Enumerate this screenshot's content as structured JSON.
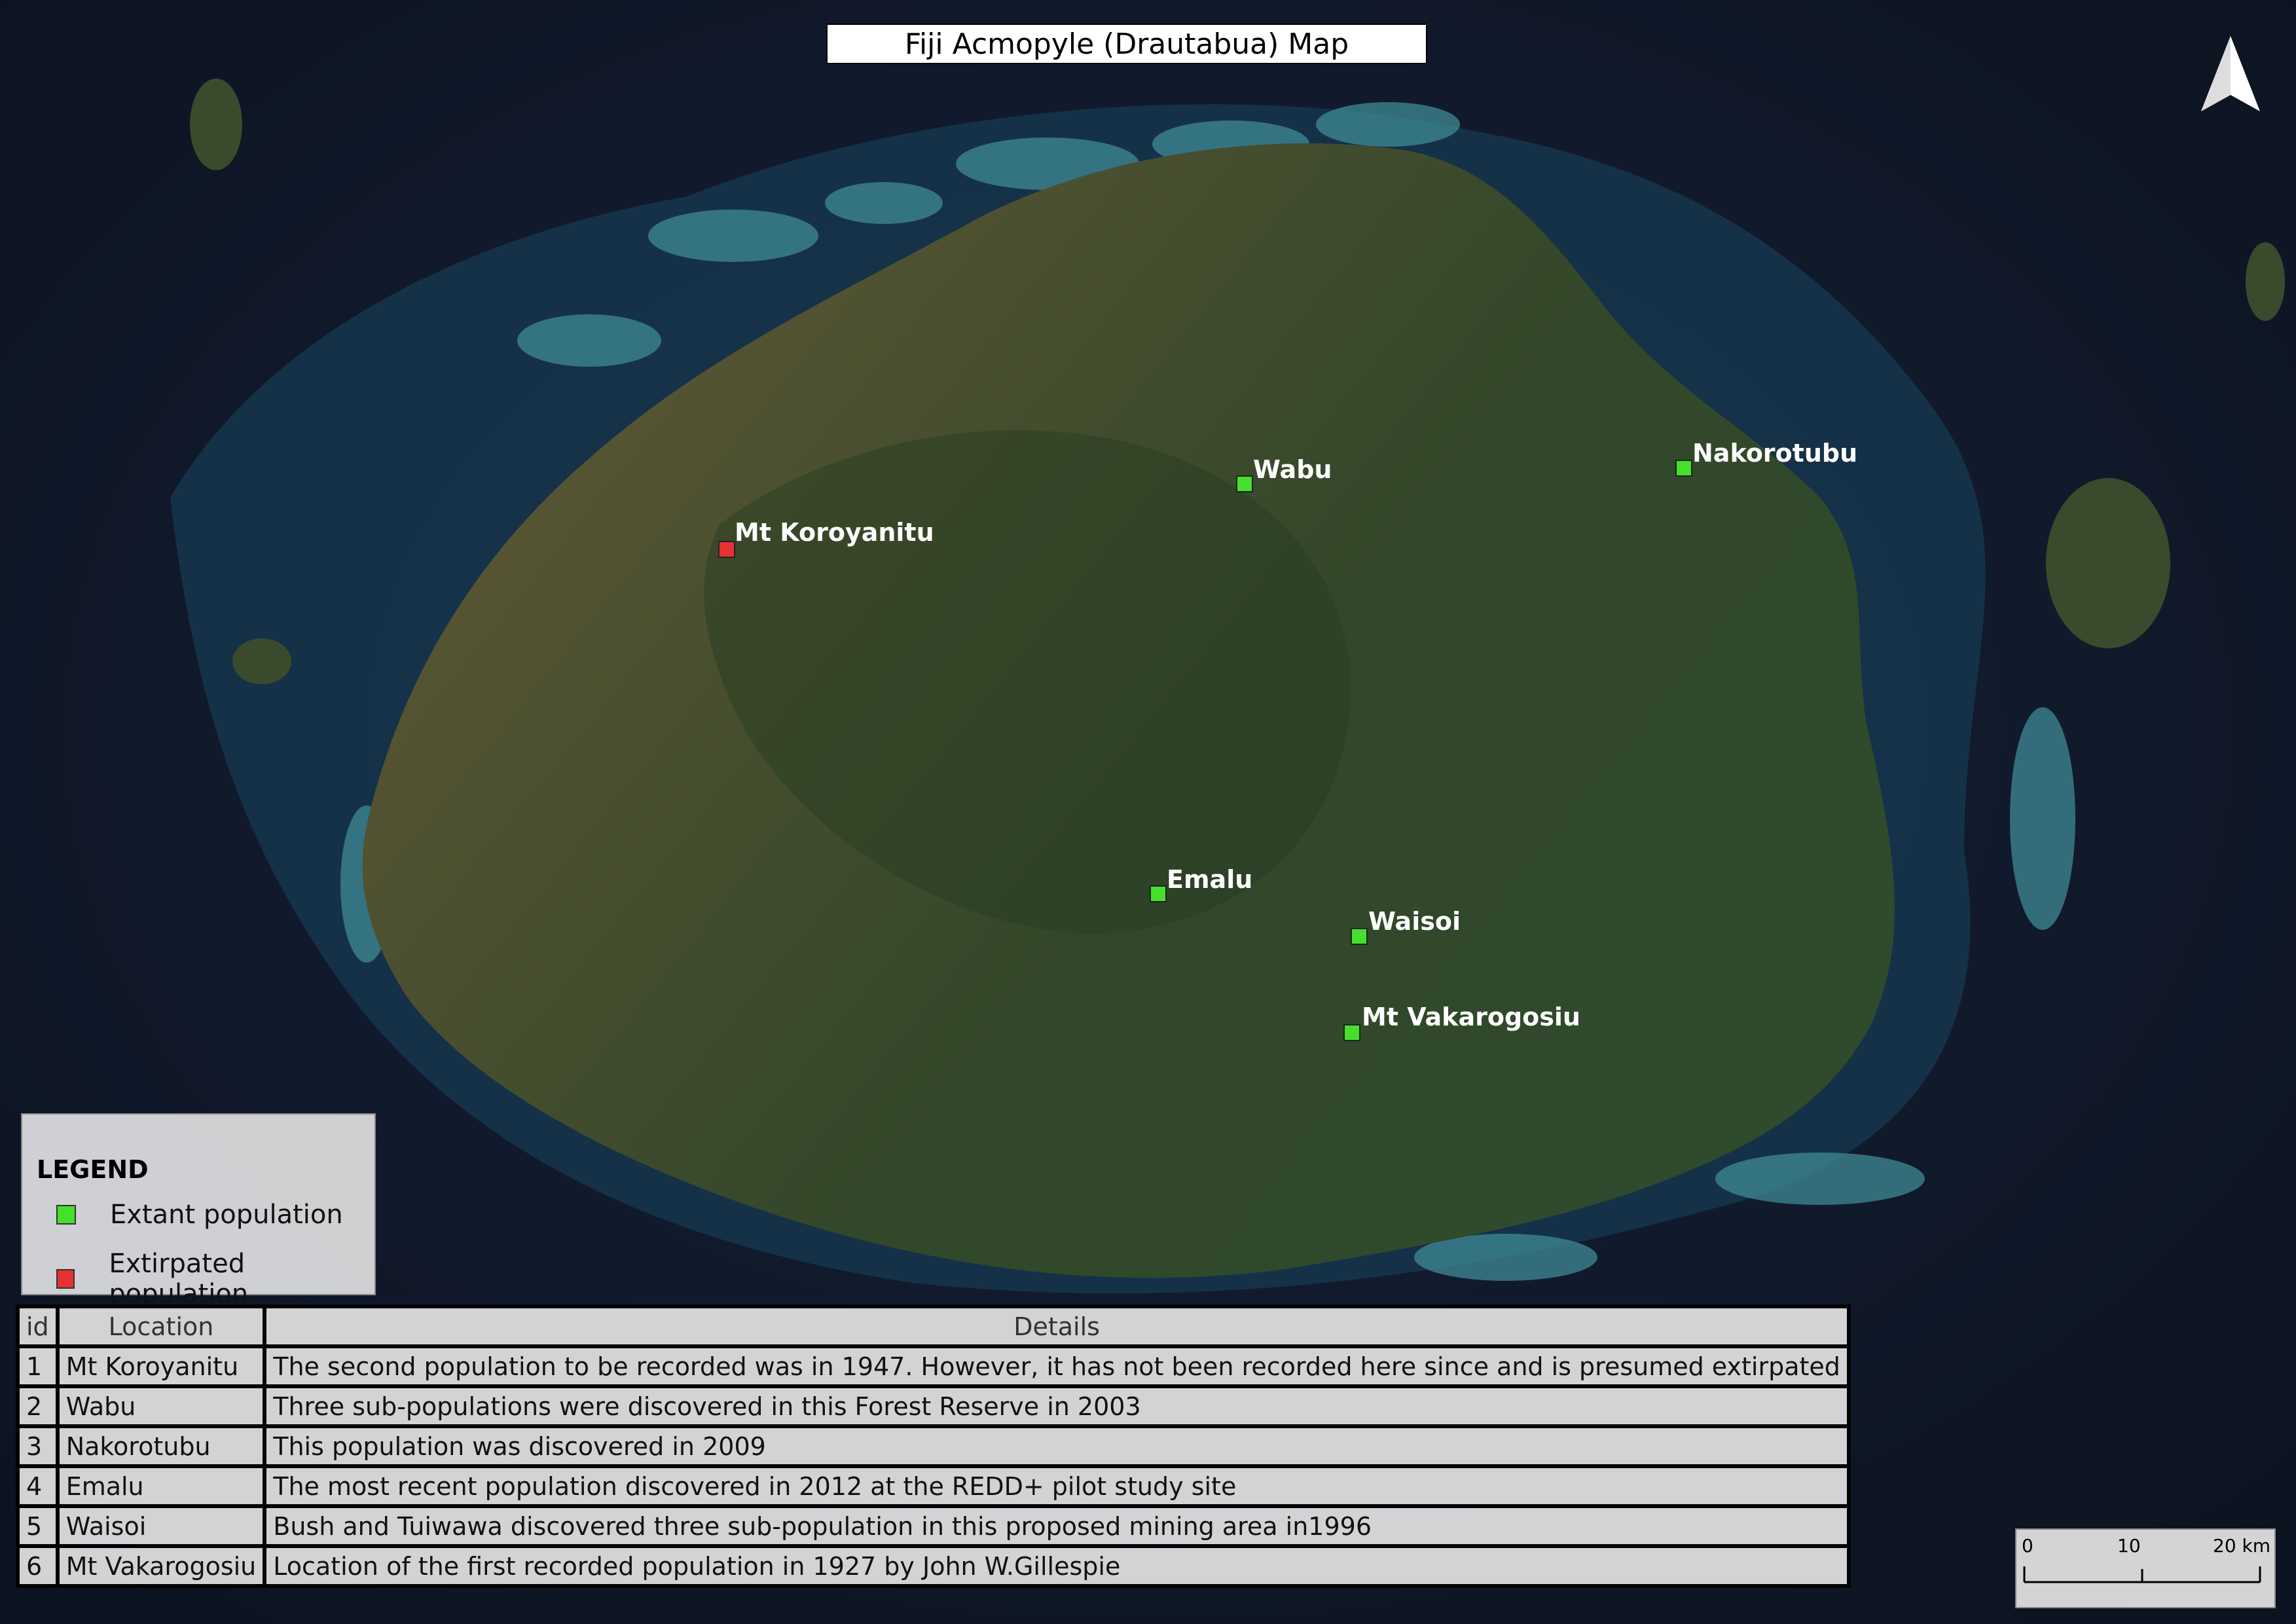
{
  "title": "Fiji Acmopyle (Drautabua) Map",
  "legend": {
    "title": "LEGEND",
    "items": [
      {
        "label": "Extant population",
        "color": "#44e02c"
      },
      {
        "label": "Extirpated population",
        "color": "#e63232"
      }
    ]
  },
  "sites": [
    {
      "name": "Mt Koroyanitu",
      "status": "extirpated"
    },
    {
      "name": "Wabu",
      "status": "extant"
    },
    {
      "name": "Nakorotubu",
      "status": "extant"
    },
    {
      "name": "Emalu",
      "status": "extant"
    },
    {
      "name": "Waisoi",
      "status": "extant"
    },
    {
      "name": "Mt Vakarogosiu",
      "status": "extant"
    }
  ],
  "table": {
    "headers": [
      "id",
      "Location",
      "Details"
    ],
    "rows": [
      [
        "1",
        "Mt Koroyanitu",
        "The second population to be recorded was in 1947. However, it has not been recorded here since and is presumed extirpated"
      ],
      [
        "2",
        "Wabu",
        "Three sub-populations were discovered in this Forest Reserve in 2003"
      ],
      [
        "3",
        "Nakorotubu",
        "This population was discovered in 2009"
      ],
      [
        "4",
        "Emalu",
        "The most recent population discovered in 2012 at the REDD+ pilot study site"
      ],
      [
        "5",
        "Waisoi",
        "Bush and Tuiwawa discovered three sub-population in this proposed mining area in1996"
      ],
      [
        "6",
        "Mt Vakarogosiu",
        "Location of the first recorded population in  1927 by John W.Gillespie"
      ]
    ]
  },
  "scale_bar": {
    "labels": [
      "0",
      "10",
      "20 km"
    ]
  },
  "colors": {
    "ocean": "#0f1726",
    "land": "#3b4a26",
    "reef": "#3f8a96"
  },
  "icons": {
    "north_arrow": "north-arrow-icon"
  }
}
